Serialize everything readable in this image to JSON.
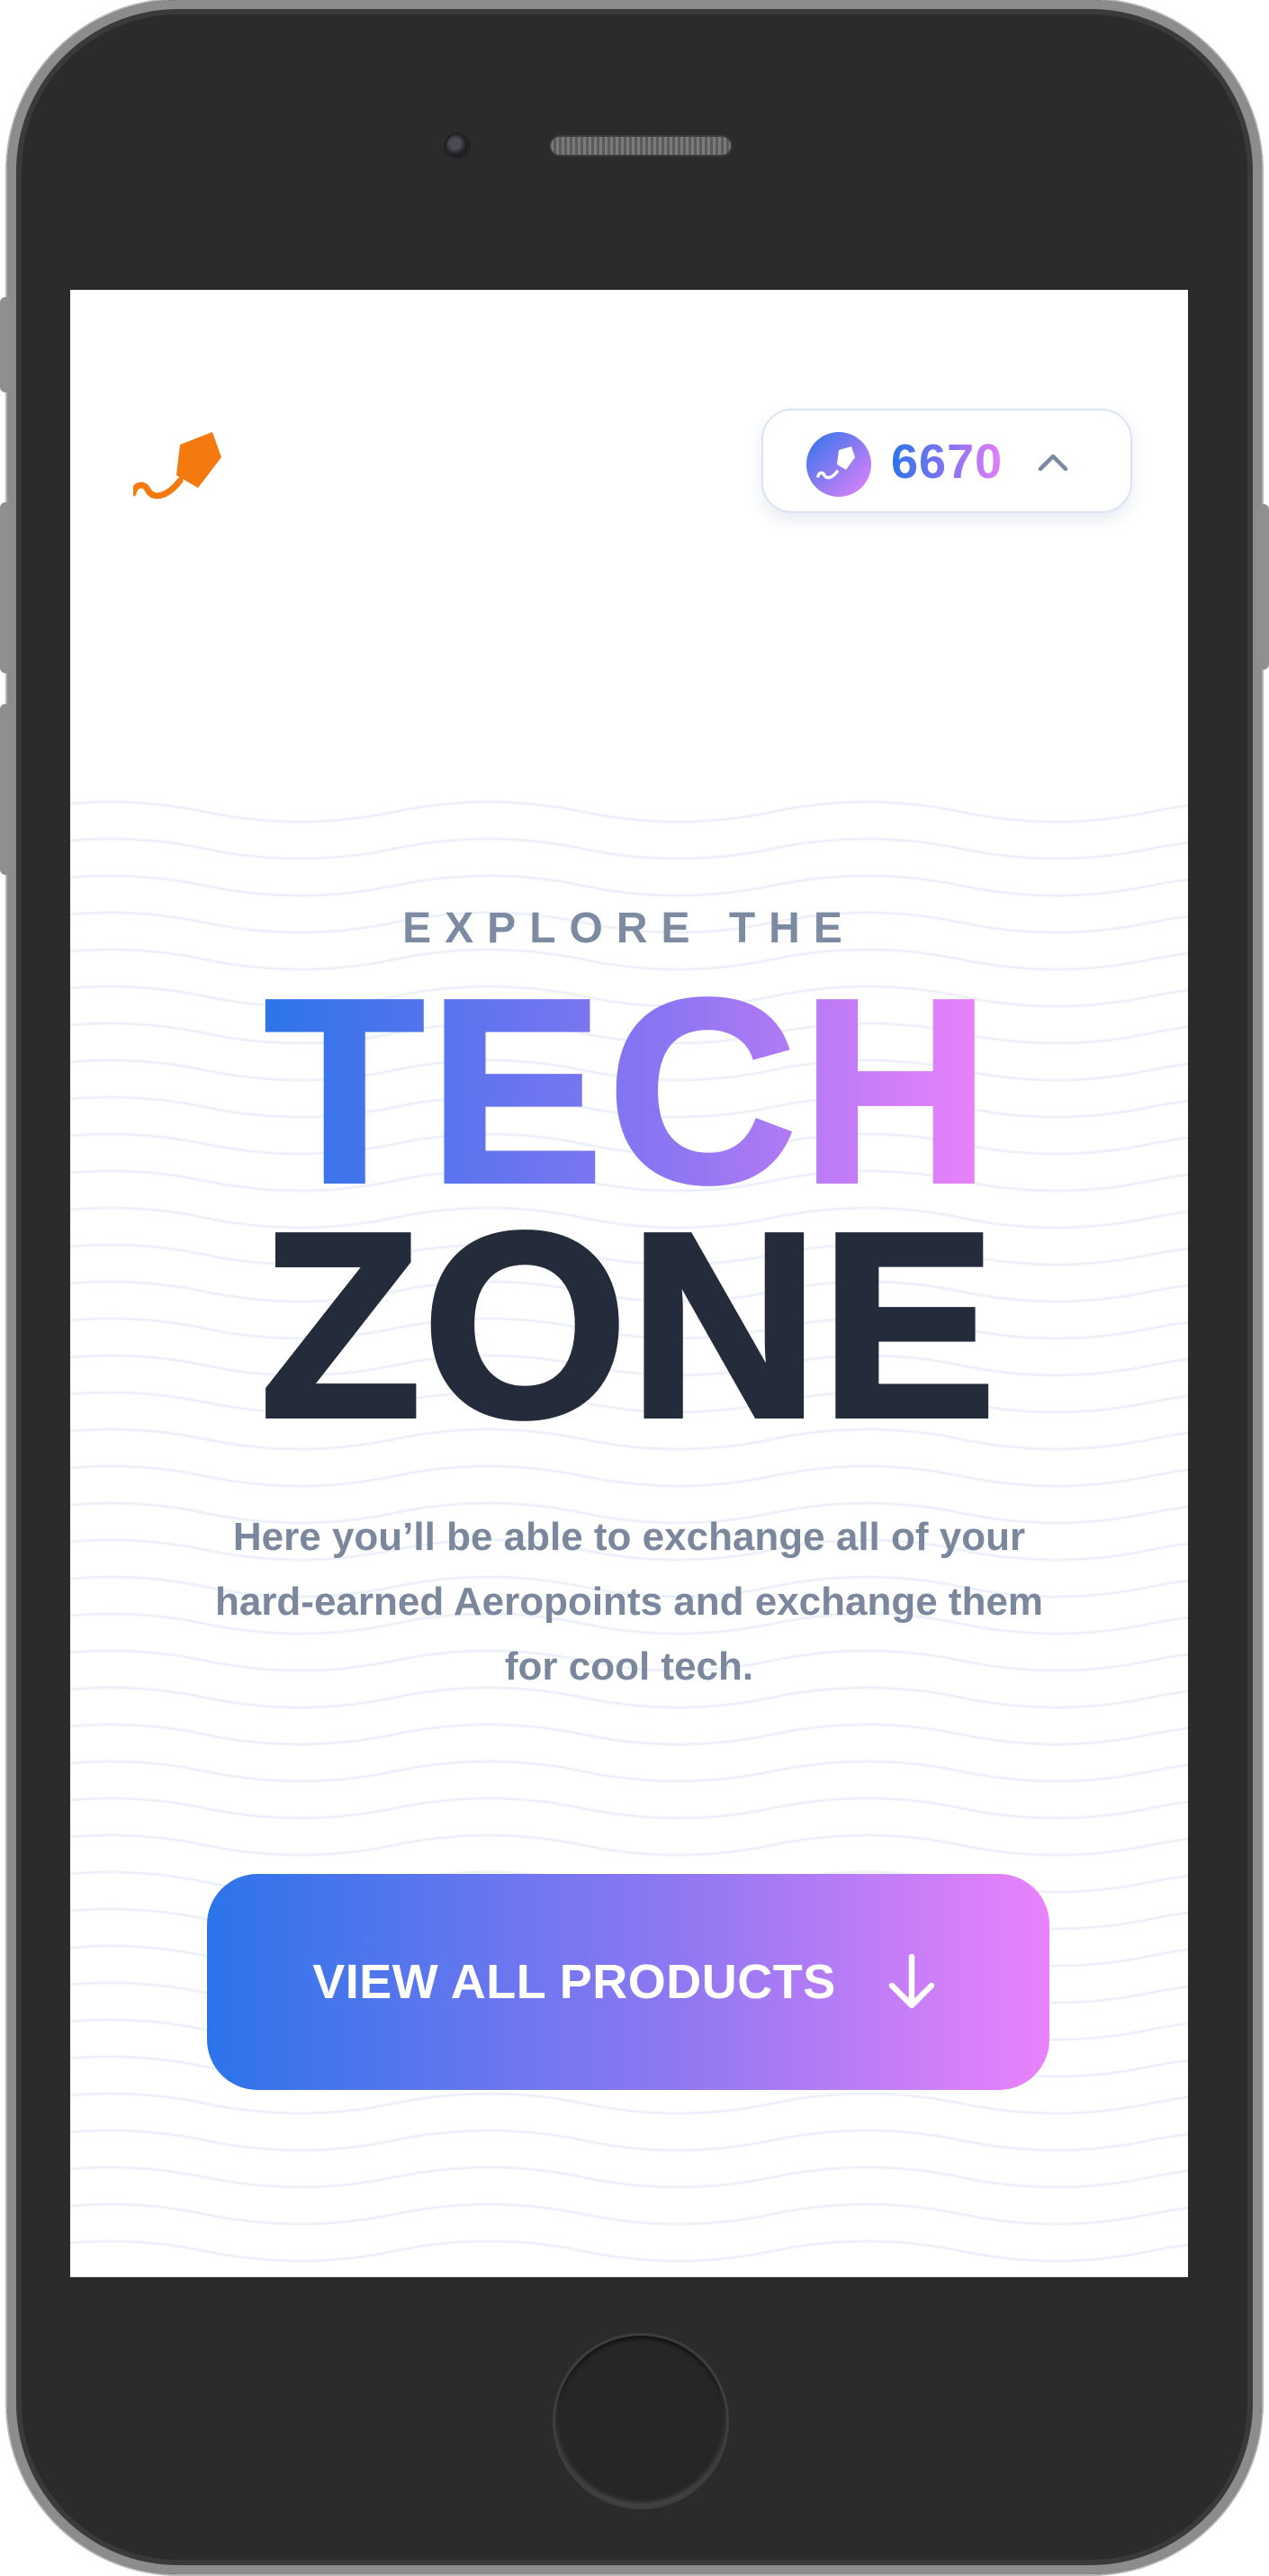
{
  "header": {
    "logo_icon": "aerolab-kite-logo-icon",
    "points": {
      "value": "6670",
      "coin_icon": "aeropoints-coin-icon",
      "toggle_icon": "chevron-up-icon"
    }
  },
  "hero": {
    "eyebrow": "EXPLORE THE",
    "headline_gradient": "TECH",
    "headline_dark": "ZONE",
    "description": "Here you’ll be able to exchange all of your hard-earned Aeropoints and exchange them for cool tech.",
    "cta": {
      "label": "VIEW ALL PRODUCTS",
      "icon": "arrow-down-icon"
    }
  },
  "colors": {
    "gradient_start": "#2d74ea",
    "gradient_mid": "#8c75f2",
    "gradient_end": "#ee82fb",
    "headline_dark": "#242c3b",
    "muted_text": "#7a879c",
    "logo_orange": "#f47a10"
  }
}
